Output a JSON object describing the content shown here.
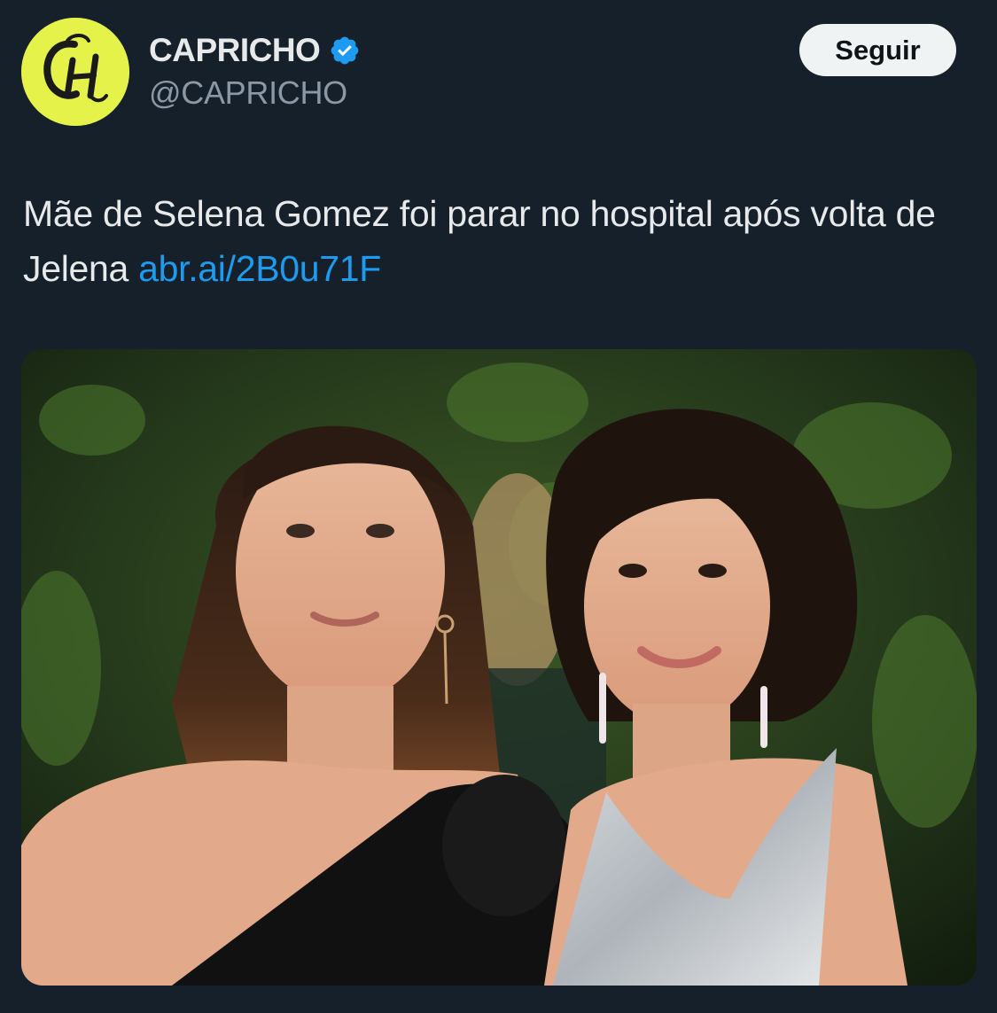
{
  "author": {
    "display_name": "CAPRICHO",
    "handle": "@CAPRICHO",
    "avatar_monogram": "CH",
    "verified": true
  },
  "actions": {
    "follow_label": "Seguir"
  },
  "tweet": {
    "text": "Mãe de Selena Gomez foi parar no hospital após volta de Jelena ",
    "link_text": "abr.ai/2B0u71F"
  },
  "media": {
    "icon": "photo",
    "alt": ""
  },
  "colors": {
    "background": "#15202b",
    "avatar": "#e4f24a",
    "link": "#1d9bf0",
    "verified": "#1d9bf0",
    "follow_button_bg": "#eff3f4",
    "handle_text": "#8b98a5"
  }
}
